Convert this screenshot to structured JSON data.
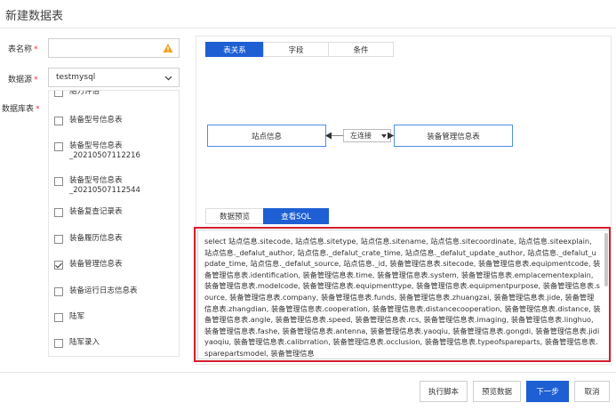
{
  "dialog": {
    "title": "新建数据表"
  },
  "form": {
    "table_name_label": "表名称",
    "table_name_value": "",
    "datasource_label": "数据源",
    "datasource_value": "testmysql",
    "tables_label": "数据库表",
    "required_mark": "*"
  },
  "table_list": [
    {
      "label": "船力评估",
      "checked": false
    },
    {
      "label": "装备型号信息表",
      "checked": false
    },
    {
      "label": "装备型号信息表_20210507112216",
      "checked": false
    },
    {
      "label": "装备型号信息表_20210507112544",
      "checked": false
    },
    {
      "label": "装备复查记录表",
      "checked": false
    },
    {
      "label": "装备履历信息表",
      "checked": false
    },
    {
      "label": "装备管理信息表",
      "checked": true
    },
    {
      "label": "装备运行日志信息表",
      "checked": false
    },
    {
      "label": "陆军",
      "checked": false
    },
    {
      "label": "陆军录入",
      "checked": false
    }
  ],
  "top_tabs": [
    {
      "label": "表关系",
      "active": true
    },
    {
      "label": "字段",
      "active": false
    },
    {
      "label": "条件",
      "active": false
    }
  ],
  "relation": {
    "left_table": "站点信息",
    "join_type": "左连接",
    "right_table": "装备管理信息表"
  },
  "bottom_tabs": [
    {
      "label": "数据预览",
      "active": false
    },
    {
      "label": "查看SQL",
      "active": true
    }
  ],
  "sql_text": "select 站点信息.sitecode, 站点信息.sitetype, 站点信息.sitename, 站点信息.sitecoordinate, 站点信息.siteexplain, 站点信息._defalut_author, 站点信息._defalut_crate_time, 站点信息._defalut_update_author, 站点信息._defalut_update_time, 站点信息._defalut_source, 站点信息._id, 装备管理信息表.sitecode, 装备管理信息表.equipmentcode, 装备管理信息表.identification, 装备管理信息表.time, 装备管理信息表.system, 装备管理信息表.emplacementexplain, 装备管理信息表.modelcode, 装备管理信息表.equipmenttype, 装备管理信息表.equipmentpurpose, 装备管理信息表.source, 装备管理信息表.company, 装备管理信息表.funds, 装备管理信息表.zhuangzai, 装备管理信息表.jide, 装备管理信息表.zhangdian, 装备管理信息表.cooperation, 装备管理信息表.distancecooperation, 装备管理信息表.distance, 装备管理信息表.angle, 装备管理信息表.speed, 装备管理信息表.rcs, 装备管理信息表.imaging, 装备管理信息表.linghuo, 装备管理信息表.fashe, 装备管理信息表.antenna, 装备管理信息表.yaoqiu, 装备管理信息表.gongdi, 装备管理信息表.jidiyaoqiu, 装备管理信息表.calibrration, 装备管理信息表.occlusion, 装备管理信息表.typeofspareparts, 装备管理信息表.sparepartsmodel, 装备管理信息",
  "footer": {
    "run_script": "执行脚本",
    "preview": "预览数据",
    "next": "下一步",
    "cancel": "取消"
  },
  "colors": {
    "primary": "#1e5fd4",
    "highlight_frame": "#d31f2d",
    "node_border": "#4f8ee8"
  }
}
